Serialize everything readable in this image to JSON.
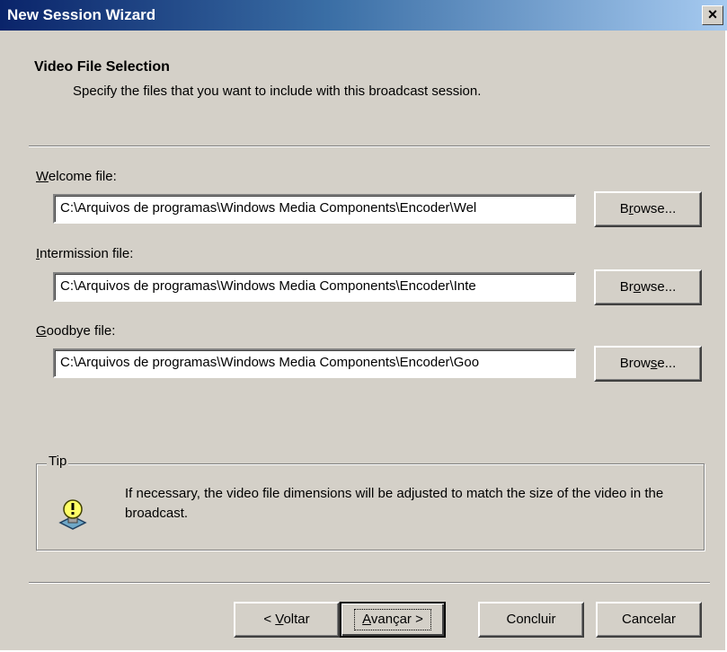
{
  "window": {
    "title": "New Session Wizard",
    "close_glyph": "×"
  },
  "header": {
    "title": "Video File Selection",
    "subtitle": "Specify the files that you want to include with this broadcast session."
  },
  "fields": [
    {
      "label_mnemonic": "W",
      "label_rest": "elcome file:",
      "value": "C:\\Arquivos de programas\\Windows Media Components\\Encoder\\Wel",
      "browse_pre": "B",
      "browse_mn": "r",
      "browse_post": "owse..."
    },
    {
      "label_mnemonic": "I",
      "label_rest": "ntermission file:",
      "value": "C:\\Arquivos de programas\\Windows Media Components\\Encoder\\Inte",
      "browse_pre": "Br",
      "browse_mn": "o",
      "browse_post": "wse..."
    },
    {
      "label_mnemonic": "G",
      "label_rest": "oodbye file:",
      "value": "C:\\Arquivos de programas\\Windows Media Components\\Encoder\\Goo",
      "browse_pre": "Brow",
      "browse_mn": "s",
      "browse_post": "e..."
    }
  ],
  "tip": {
    "label": "Tip",
    "icon": "lightbulb-icon",
    "text": "If necessary, the video file dimensions will be adjusted to match the size of the video in the broadcast."
  },
  "footer": {
    "back_pre": "< ",
    "back_mn": "V",
    "back_post": "oltar",
    "next_mn": "A",
    "next_post": "vançar >",
    "finish": "Concluir",
    "cancel": "Cancelar"
  }
}
